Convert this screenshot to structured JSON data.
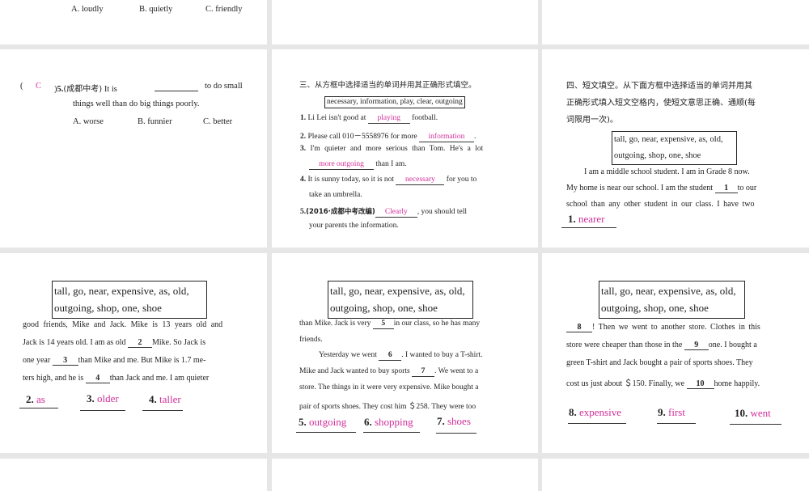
{
  "p1": {
    "opts": [
      "A. loudly",
      "B. quietly",
      "C. friendly"
    ]
  },
  "p2": {
    "paren_open": "(",
    "answer": "C",
    "paren_close": ")",
    "num": "5.",
    "src": "(成都中考)",
    "q1a": "It is",
    "q1b": "to do small",
    "q2": "things well than do big things poorly.",
    "opts": [
      "A. worse",
      "B. funnier",
      "C. better"
    ]
  },
  "p3": {
    "title": "三、从方框中选择适当的单词并用其正确形式填空。",
    "box": "necessary, information, play, clear, outgoing",
    "items": [
      {
        "n": "1.",
        "a": "Li Lei isn't good at",
        "ans": "playing",
        "b": "football."
      },
      {
        "n": "2.",
        "a": "Please call 010－5558976 for more",
        "ans": "information",
        "b": "."
      },
      {
        "n": "3.",
        "a": "I'm quieter and more serious than Tom. He's a lot",
        "ans": "more outgoing",
        "b": "than I am."
      },
      {
        "n": "4.",
        "a": "It is sunny today, so it is not",
        "ans": "necessary",
        "b": "for you to",
        "c": "take an umbrella."
      },
      {
        "n": "5.",
        "src": "(2016·成都中考改编)",
        "ans": "Clearly",
        "b": ", you should tell",
        "c": "your parents the information."
      }
    ]
  },
  "p4": {
    "title1": "四、短文填空。从下面方框中选择适当的单词并用其",
    "title2": "正确形式填入短文空格内，使短文意思正确、通顺(每",
    "title3": "词限用一次)。",
    "line1": "I am a middle school student. I am in Grade 8 now.",
    "line2a": "My home is near our school. I am the student",
    "b1": "1",
    "line2b": "to our",
    "line3": "school than any other student in our class. I have two",
    "ans_num": "1.",
    "ans": "nearer"
  },
  "word_box": {
    "line1": "tall, go, near, expensive, as, old,",
    "line2": "outgoing, shop, one, shoe"
  },
  "p5": {
    "l1": "good friends, Mike and Jack. Mike is 13 years old and",
    "l2a": "Jack is 14 years old. I am as old",
    "b2": "2",
    "l2b": "Mike. So Jack is",
    "l3a": "one year",
    "b3": "3",
    "l3b": "than Mike and me. But Mike is 1.7 me-",
    "l4a": "ters high, and he is",
    "b4": "4",
    "l4b": "than Jack and me. I am quieter",
    "answers": [
      {
        "n": "2.",
        "a": "as"
      },
      {
        "n": "3.",
        "a": "older"
      },
      {
        "n": "4.",
        "a": "taller"
      }
    ]
  },
  "p6": {
    "l1a": "than Mike. Jack is very",
    "b5": "5",
    "l1b": "in our class, so he has many",
    "l2": "friends.",
    "l3a": "Yesterday we went",
    "b6": "6",
    "l3b": ". I wanted to buy a T-shirt.",
    "l4a": "Mike and Jack wanted to buy sports",
    "b7": "7",
    "l4b": ". We went to a",
    "l5": "store. The things in it were very expensive. Mike bought a",
    "l6": "pair of sports shoes. They cost him ＄258. They were too",
    "answers": [
      {
        "n": "5.",
        "a": "outgoing"
      },
      {
        "n": "6.",
        "a": "shopping"
      },
      {
        "n": "7.",
        "a": "shoes"
      }
    ]
  },
  "p7": {
    "b8": "8",
    "l1": "! Then we went to another store. Clothes in this",
    "l2a": "store were cheaper than those in the",
    "b9": "9",
    "l2b": "one. I bought a",
    "l3": "green T-shirt and Jack bought a pair of sports shoes. They",
    "l4a": "cost us just about ＄150. Finally, we",
    "b10": "10",
    "l4b": "home happily.",
    "answers": [
      {
        "n": "8.",
        "a": "expensive"
      },
      {
        "n": "9.",
        "a": "first"
      },
      {
        "n": "10.",
        "a": "went"
      }
    ]
  }
}
